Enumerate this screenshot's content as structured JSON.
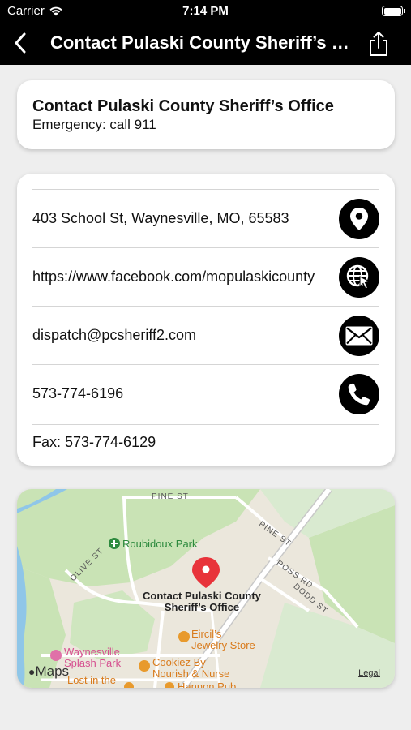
{
  "status_bar": {
    "carrier": "Carrier",
    "time": "7:14 PM"
  },
  "nav": {
    "title": "Contact Pulaski County Sheriff’s Office",
    "back_icon": "chevron-left-icon",
    "share_icon": "share-icon"
  },
  "header_card": {
    "title": "Contact Pulaski County Sheriff’s Office",
    "subtitle": "Emergency: call 911"
  },
  "contact_rows": [
    {
      "text": "403 School St, Waynesville, MO, 65583",
      "icon": "location-pin-icon"
    },
    {
      "text": "https://www.facebook.com/mopulaskicounty",
      "icon": "globe-cursor-icon"
    },
    {
      "text": "dispatch@pcsheriff2.com",
      "icon": "envelope-icon"
    },
    {
      "text": "573-774-6196",
      "icon": "phone-icon"
    }
  ],
  "fax": "Fax: 573-774-6129",
  "map": {
    "roads": [
      "PINE ST",
      "PINE ST",
      "OLIVE ST",
      "ROSS RD",
      "DODD ST"
    ],
    "park": "Roubidoux Park",
    "pin_label": [
      "Contact Pulaski County",
      "Sheriff’s Office"
    ],
    "pois": [
      [
        "Eircil’s",
        "Jewelry Store"
      ],
      [
        "Cookiez By",
        "Nourish & Nurse"
      ]
    ],
    "poi_pink": [
      "Waynesville",
      "Splash Park"
    ],
    "cutoff_labels": [
      "Lost in the",
      "Hannon Pub"
    ],
    "brand": "Maps",
    "legal": "Legal"
  },
  "colors": {
    "bar_bg": "#000000",
    "page_bg": "#eeeeee",
    "pin_red": "#e8333a",
    "park_green": "#2d8a3e"
  }
}
